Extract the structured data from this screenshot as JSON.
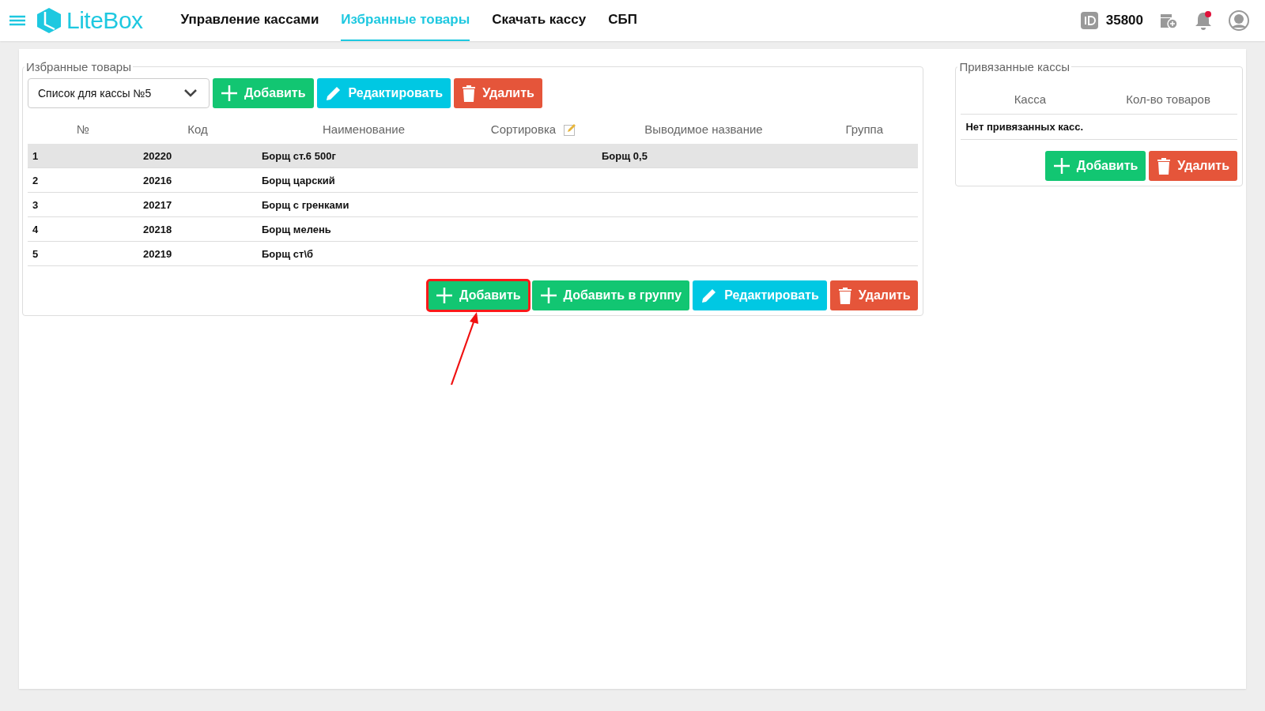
{
  "header": {
    "logo": "LiteBox",
    "nav": [
      {
        "label": "Управление кассами",
        "selected": false
      },
      {
        "label": "Избранные товары",
        "selected": true
      },
      {
        "label": "Скачать кассу",
        "selected": false
      },
      {
        "label": "СБП",
        "selected": false
      }
    ],
    "account_id": "35800",
    "notification_unread": true
  },
  "favorites": {
    "title": "Избранные товары",
    "list_select": {
      "value": "Список для кассы №5"
    },
    "top_buttons": [
      {
        "kind": "add",
        "label": "Добавить",
        "highlighted": false
      },
      {
        "kind": "edit",
        "label": "Редактировать",
        "highlighted": false
      },
      {
        "kind": "delete",
        "label": "Удалить",
        "highlighted": false
      }
    ],
    "table": {
      "columns": [
        "№",
        "Код",
        "Наименование",
        "Сортировка",
        "Выводимое название",
        "Группа"
      ],
      "rows": [
        {
          "cells": [
            "1",
            "20220",
            "Борщ ст.6 500г",
            "",
            "Борщ 0,5",
            ""
          ],
          "selected": true
        },
        {
          "cells": [
            "2",
            "20216",
            "Борщ царский",
            "",
            "",
            ""
          ],
          "selected": false
        },
        {
          "cells": [
            "3",
            "20217",
            "Борщ с гренками",
            "",
            "",
            ""
          ],
          "selected": false
        },
        {
          "cells": [
            "4",
            "20218",
            "Борщ мелень",
            "",
            "",
            ""
          ],
          "selected": false
        },
        {
          "cells": [
            "5",
            "20219",
            "Борщ ст\\б",
            "",
            "",
            ""
          ],
          "selected": false
        }
      ]
    },
    "bottom_buttons": [
      {
        "kind": "add",
        "label": "Добавить",
        "highlighted": true
      },
      {
        "kind": "add",
        "label": "Добавить в группу",
        "highlighted": false
      },
      {
        "kind": "edit",
        "label": "Редактировать",
        "highlighted": false
      },
      {
        "kind": "delete",
        "label": "Удалить",
        "highlighted": false
      }
    ]
  },
  "linked_registers": {
    "title": "Привязанные кассы",
    "columns": [
      "Касса",
      "Кол-во товаров"
    ],
    "empty_message": "Нет привязанных касс.",
    "buttons": [
      {
        "kind": "add",
        "label": "Добавить",
        "highlighted": false
      },
      {
        "kind": "delete",
        "label": "Удалить",
        "highlighted": false
      }
    ]
  }
}
